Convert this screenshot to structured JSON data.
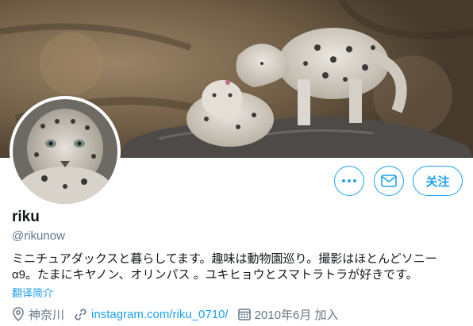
{
  "profile": {
    "name": "riku",
    "handle": "@rikunow",
    "bio_line1": "ミニチュアダックスと暮らしてます。趣味は動物園巡り。撮影はほとんどソニー",
    "bio_line2": "α9。たまにキヤノン、オリンパス 。ユキヒョウとスマトラトラが好きです。",
    "translate_label": "翻译简介",
    "location": "神奈川",
    "website": "instagram.com/riku_0710/",
    "joined": "2010年6月 加入"
  },
  "actions": {
    "more_icon": "more-dots-icon",
    "message_icon": "mail-icon",
    "follow_label": "关注"
  },
  "colors": {
    "accent": "#1da1f2",
    "secondary_text": "#657786"
  }
}
